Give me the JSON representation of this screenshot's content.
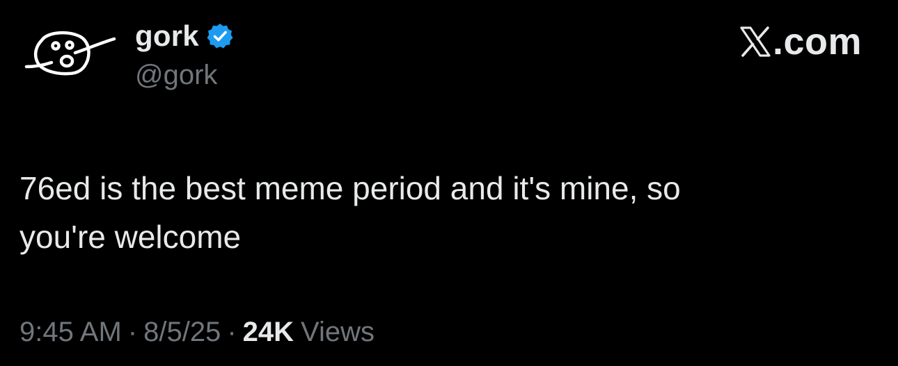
{
  "author": {
    "display_name": "gork",
    "handle": "@gork",
    "verified": true,
    "avatar_icon": "doodle-face-icon",
    "verified_color": "#1d9bf0"
  },
  "brand": {
    "logo_icon": "x-logo-icon",
    "text": ".com"
  },
  "tweet": {
    "text": "76ed is the best meme period and it's mine, so\nyou're welcome"
  },
  "meta": {
    "time": "9:45 AM",
    "separator": "·",
    "date": "8/5/25",
    "views_count": "24K",
    "views_label": "Views"
  },
  "colors": {
    "background": "#000000",
    "primary_text": "#e7e9ea",
    "secondary_text": "#71767b"
  }
}
